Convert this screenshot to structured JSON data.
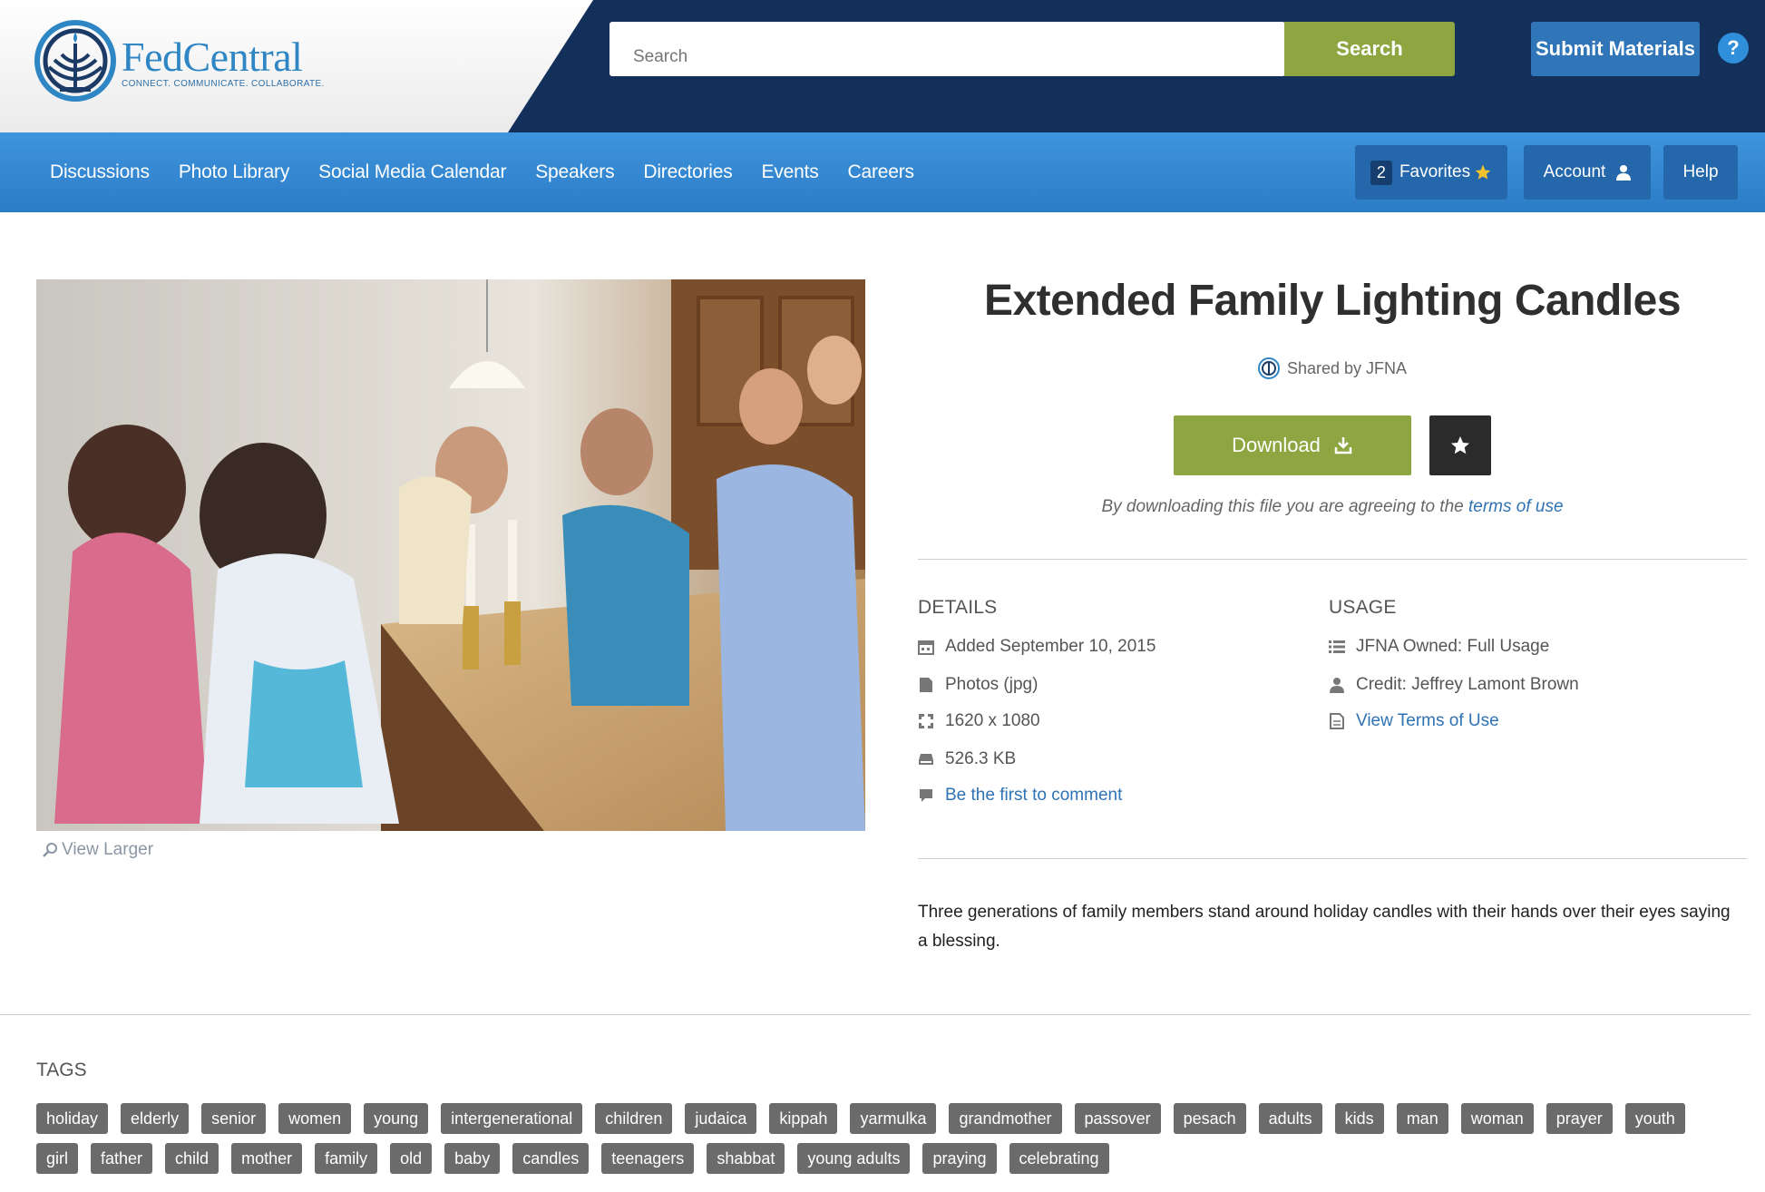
{
  "header": {
    "logo_name": "FedCentral",
    "logo_tagline": "CONNECT. COMMUNICATE. COLLABORATE.",
    "search_placeholder": "Search",
    "search_button": "Search",
    "submit_button": "Submit Materials",
    "help_label": "?"
  },
  "nav": {
    "items": [
      "Discussions",
      "Photo Library",
      "Social Media Calendar",
      "Speakers",
      "Directories",
      "Events",
      "Careers"
    ],
    "favorites_count": "2",
    "favorites_label": "Favorites",
    "account_label": "Account",
    "help_label": "Help"
  },
  "asset": {
    "title": "Extended Family Lighting Candles",
    "shared_by": "Shared by JFNA",
    "download_label": "Download",
    "agree_text": "By downloading this file you are agreeing to the ",
    "agree_link": "terms of use",
    "view_larger": "View Larger",
    "description": "Three generations of family members stand around holiday candles with their hands over their eyes saying a blessing."
  },
  "details": {
    "heading": "DETAILS",
    "added": "Added September 10, 2015",
    "type": "Photos (jpg)",
    "dimensions": "1620 x 1080",
    "size": "526.3 KB",
    "comment_link": "Be the first to comment"
  },
  "usage": {
    "heading": "USAGE",
    "ownership": "JFNA Owned: Full Usage",
    "credit": "Credit: Jeffrey Lamont Brown",
    "terms_link": "View Terms of Use"
  },
  "tags": {
    "heading": "TAGS",
    "items": [
      "holiday",
      "elderly",
      "senior",
      "women",
      "young",
      "intergenerational",
      "children",
      "judaica",
      "kippah",
      "yarmulka",
      "grandmother",
      "passover",
      "pesach",
      "adults",
      "kids",
      "man",
      "woman",
      "prayer",
      "youth",
      "girl",
      "father",
      "child",
      "mother",
      "family",
      "old",
      "baby",
      "candles",
      "teenagers",
      "shabbat",
      "young adults",
      "praying",
      "celebrating"
    ]
  },
  "colors": {
    "header_bg": "#12305a",
    "nav_bg": "#2f85d0",
    "accent_green": "#8ea641",
    "accent_blue": "#2f75b8",
    "link": "#2f72b3",
    "tag_bg": "#6b6b6b"
  },
  "icons": [
    "menorah-logo-icon",
    "help-icon",
    "star-icon",
    "user-icon",
    "download-icon",
    "calendar-icon",
    "file-icon",
    "dimensions-icon",
    "drive-icon",
    "comment-icon",
    "list-icon",
    "document-icon",
    "zoom-icon"
  ]
}
